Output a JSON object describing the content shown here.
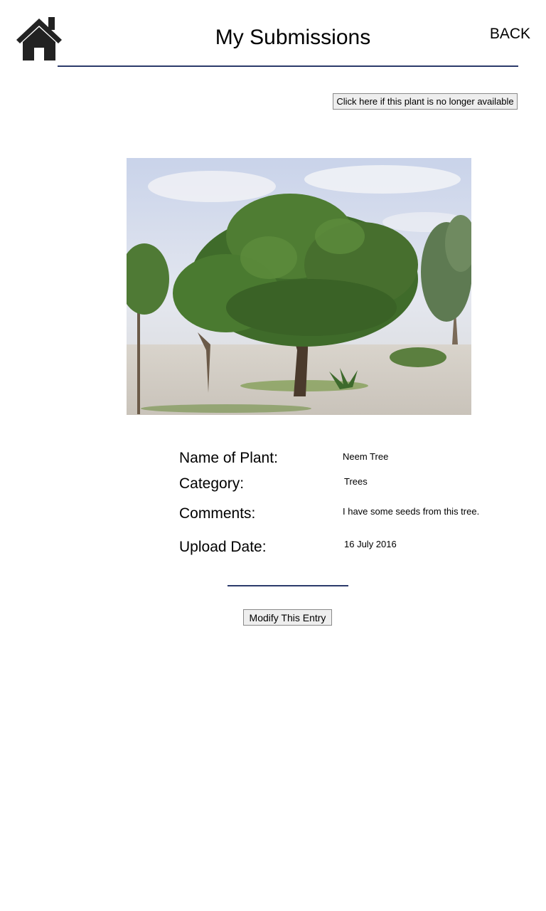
{
  "header": {
    "home_icon": "home-icon",
    "title": "My Submissions",
    "back_label": "BACK",
    "rule_color": "#2b3a6b"
  },
  "actions": {
    "unavailable_label": "Click here if this plant is no longer available",
    "modify_label": "Modify This Entry"
  },
  "photo": {
    "alt": "Neem Tree"
  },
  "details": {
    "name_label": "Name of Plant:",
    "name_value": "Neem Tree",
    "category_label": "Category:",
    "category_value": "Trees",
    "comments_label": "Comments:",
    "comments_value": "I have some seeds from this tree.",
    "date_label": "Upload Date:",
    "date_value": "16 July 2016"
  }
}
